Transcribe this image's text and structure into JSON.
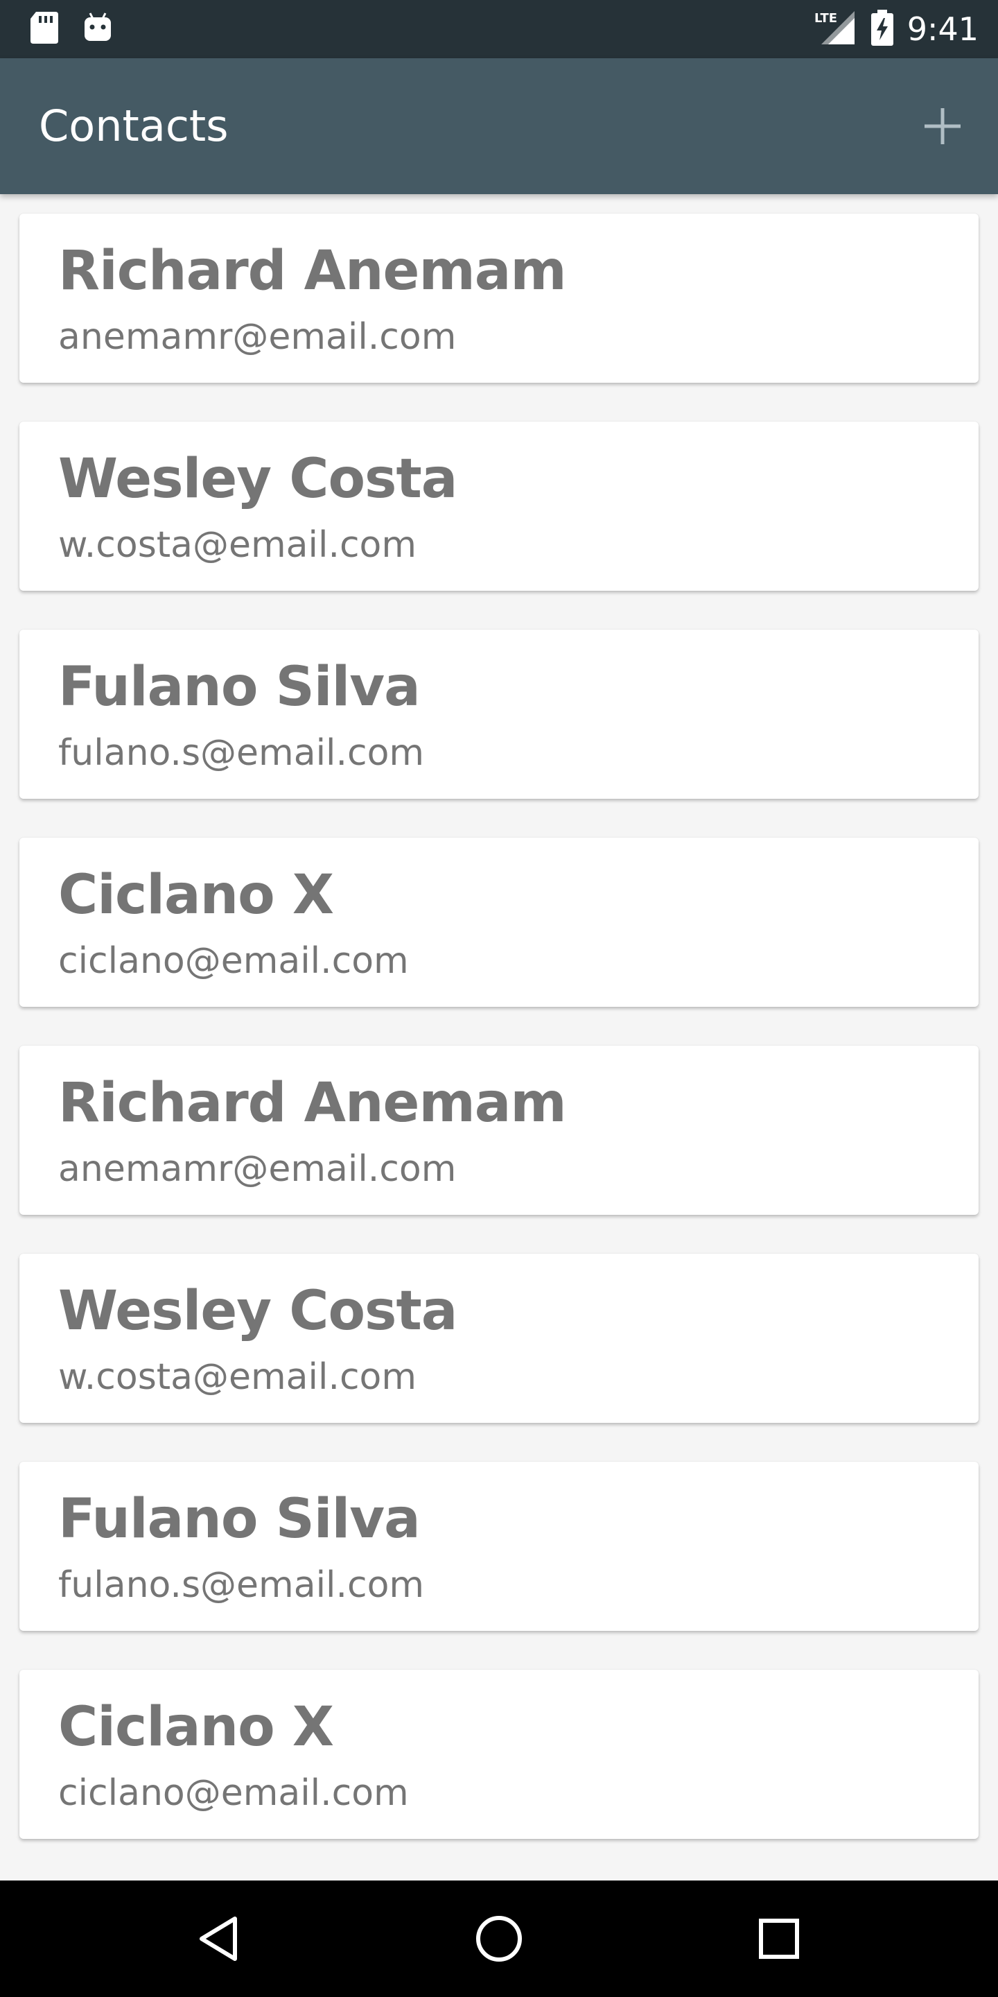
{
  "status_bar": {
    "time": "9:41",
    "network": "LTE",
    "icons": [
      "sd-card-icon",
      "android-icon",
      "lte-signal-icon",
      "battery-charging-icon"
    ]
  },
  "app_bar": {
    "title": "Contacts",
    "add_icon": "plus-icon"
  },
  "contacts": [
    {
      "name": "Richard Anemam",
      "email": "anemamr@email.com"
    },
    {
      "name": "Wesley Costa",
      "email": "w.costa@email.com"
    },
    {
      "name": "Fulano Silva",
      "email": "fulano.s@email.com"
    },
    {
      "name": "Ciclano X",
      "email": "ciclano@email.com"
    },
    {
      "name": "Richard Anemam",
      "email": "anemamr@email.com"
    },
    {
      "name": "Wesley Costa",
      "email": "w.costa@email.com"
    },
    {
      "name": "Fulano Silva",
      "email": "fulano.s@email.com"
    },
    {
      "name": "Ciclano X",
      "email": "ciclano@email.com"
    }
  ],
  "nav_bar": {
    "icons": [
      "back-icon",
      "home-icon",
      "recents-icon"
    ]
  },
  "colors": {
    "status_bar": "#263238",
    "app_bar": "#455a64",
    "background": "#f5f5f5",
    "card": "#ffffff",
    "text": "#757575",
    "nav_bar": "#000000"
  }
}
